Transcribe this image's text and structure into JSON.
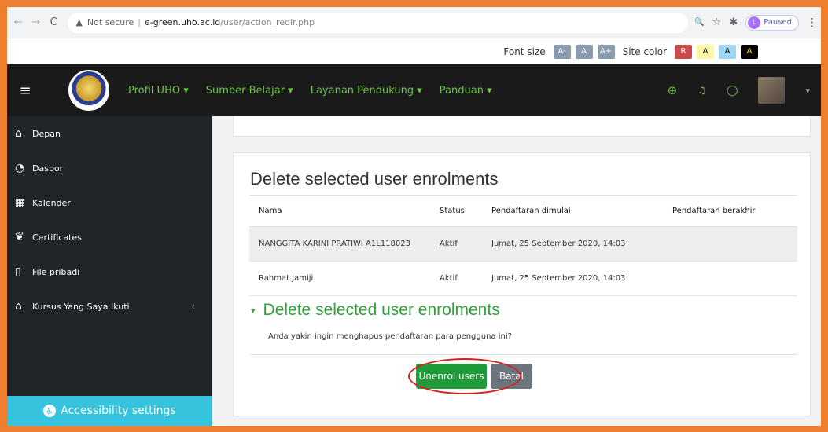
{
  "browser": {
    "back_icon": "←",
    "forward_icon": "→",
    "reload_icon": "C",
    "warning_icon": "▲",
    "security_label": "Not secure",
    "separator": "|",
    "host": "e-green.uho.ac.id",
    "path": "/user/action_redir.php",
    "zoom_icon": "🔍",
    "star_icon": "☆",
    "extensions_icon": "✱",
    "profile_initial": "L",
    "paused_label": "Paused",
    "menu_icon": "⋮"
  },
  "a11y_bar": {
    "font_size_label": "Font size",
    "font_buttons": [
      "A-",
      "A",
      "A+"
    ],
    "site_color_label": "Site color",
    "color_buttons": [
      {
        "label": "R",
        "bg": "#c94a4a",
        "fg": "#fff"
      },
      {
        "label": "A",
        "bg": "#fff6a8",
        "fg": "#111"
      },
      {
        "label": "A",
        "bg": "#9fd5f2",
        "fg": "#111"
      },
      {
        "label": "A",
        "bg": "#000000",
        "fg": "#ffd400"
      }
    ]
  },
  "navbar": {
    "hamburger_icon": "≡",
    "menu": [
      "Profil UHO ▾",
      "Sumber Belajar ▾",
      "Layanan Pendukung ▾",
      "Panduan ▾"
    ],
    "globe_icon": "⊕",
    "bell_icon": "♫",
    "chat_icon": "◯",
    "user_caret": "▾",
    "accent": "#6cc24a"
  },
  "sidebar": {
    "items": [
      {
        "icon": "⌂",
        "label": "Depan"
      },
      {
        "icon": "◔",
        "label": "Dasbor"
      },
      {
        "icon": "▦",
        "label": "Kalender"
      },
      {
        "icon": "❦",
        "label": "Certificates"
      },
      {
        "icon": "▯",
        "label": "File pribadi"
      },
      {
        "icon": "⌂",
        "label": "Kursus Yang Saya Ikuti",
        "chevron": "‹"
      }
    ],
    "accessibility_icon": "♿",
    "accessibility_label": "Accessibility settings"
  },
  "main": {
    "card_title": "Delete selected user enrolments",
    "table": {
      "headers": [
        "Nama",
        "Status",
        "Pendaftaran dimulai",
        "Pendaftaran berakhir"
      ],
      "rows": [
        [
          "NANGGITA KARINI PRATIWI A1L118023",
          "Aktif",
          "Jumat, 25 September 2020, 14:03",
          ""
        ],
        [
          "Rahmat Jamiji",
          "Aktif",
          "Jumat, 25 September 2020, 14:03",
          ""
        ]
      ]
    },
    "section_toggle_icon": "▾",
    "section_title": "Delete selected user enrolments",
    "confirm_text": "Anda yakin ingin menghapus pendaftaran para pengguna ini?",
    "unenrol_button": "Unenrol users",
    "cancel_button": "Batal"
  }
}
